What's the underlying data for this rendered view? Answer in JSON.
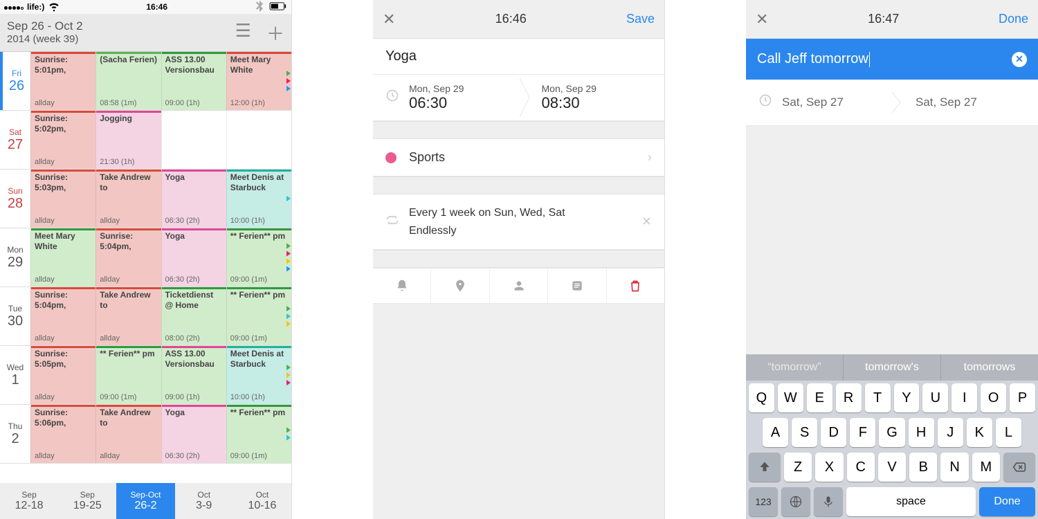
{
  "screen1": {
    "statusbar": {
      "carrier": "life:)",
      "time": "16:46"
    },
    "header": {
      "range": "Sep 26 - Oct 2",
      "subtitle": "2014 (week 39)"
    },
    "days": [
      {
        "dow": "Fri",
        "num": "26",
        "today": true,
        "events": [
          {
            "title": "Sunrise: 5:01pm,",
            "time": "allday",
            "bg": "#f2c7c3",
            "bar": "#d94a3a"
          },
          {
            "title": "(Sacha Ferien)",
            "time": "08:58 (1m)",
            "bg": "#d1eccb",
            "bar": "#5fb35b"
          },
          {
            "title": "ASS 13.00 Versionsbau",
            "time": "09:00 (1h)",
            "bg": "#d1eccb",
            "bar": "#2e9a3e"
          },
          {
            "title": "Meet Mary White",
            "time": "12:00 (1h)",
            "bg": "#f2c7c3",
            "bar": "#d94a3a"
          }
        ],
        "markers": [
          "#4caf50",
          "#e91e63",
          "#2196f3"
        ]
      },
      {
        "dow": "Sat",
        "num": "27",
        "weekend": true,
        "events": [
          {
            "title": "Sunrise: 5:02pm,",
            "time": "allday",
            "bg": "#f2c7c3",
            "bar": "#d94a3a"
          },
          {
            "title": "Jogging",
            "time": "21:30 (1h)",
            "bg": "#f4d3e3",
            "bar": "#e04893"
          },
          {
            "empty": true
          },
          {
            "empty": true
          }
        ]
      },
      {
        "dow": "Sun",
        "num": "28",
        "weekend": true,
        "events": [
          {
            "title": "Sunrise: 5:03pm,",
            "time": "allday",
            "bg": "#f2c7c3",
            "bar": "#d94a3a"
          },
          {
            "title": "Take Andrew to",
            "time": "allday",
            "bg": "#f2c7c3",
            "bar": "#d94a3a"
          },
          {
            "title": "Yoga",
            "time": "06:30 (2h)",
            "bg": "#f4d3e3",
            "bar": "#e04893"
          },
          {
            "title": "Meet Denis at Starbuck",
            "time": "10:00 (1h)",
            "bg": "#c6ece6",
            "bar": "#1fb2a0"
          }
        ],
        "markers": [
          "#26c6da"
        ]
      },
      {
        "dow": "Mon",
        "num": "29",
        "events": [
          {
            "title": "Meet Mary White",
            "time": "allday",
            "bg": "#d1eccb",
            "bar": "#2e9a3e"
          },
          {
            "title": "Sunrise: 5:04pm,",
            "time": "allday",
            "bg": "#f2c7c3",
            "bar": "#d94a3a"
          },
          {
            "title": "Yoga",
            "time": "06:30 (2h)",
            "bg": "#f4d3e3",
            "bar": "#e04893"
          },
          {
            "title": "** Ferien** pm",
            "time": "09:00 (1m)",
            "bg": "#d1eccb",
            "bar": "#2e9a3e"
          }
        ],
        "markers": [
          "#4caf50",
          "#e91e63",
          "#ffc107",
          "#2196f3"
        ]
      },
      {
        "dow": "Tue",
        "num": "30",
        "events": [
          {
            "title": "Sunrise: 5:04pm,",
            "time": "allday",
            "bg": "#f2c7c3",
            "bar": "#d94a3a"
          },
          {
            "title": "Take Andrew to",
            "time": "allday",
            "bg": "#f2c7c3",
            "bar": "#d94a3a"
          },
          {
            "title": "Ticketdienst @ Home",
            "time": "08:00 (2h)",
            "bg": "#d1eccb",
            "bar": "#2e9a3e"
          },
          {
            "title": "** Ferien** pm",
            "time": "09:00 (1m)",
            "bg": "#d1eccb",
            "bar": "#2e9a3e"
          }
        ],
        "markers": [
          "#4caf50",
          "#26c6da",
          "#ffc107"
        ]
      },
      {
        "dow": "Wed",
        "num": "1",
        "events": [
          {
            "title": "Sunrise: 5:05pm,",
            "time": "allday",
            "bg": "#f2c7c3",
            "bar": "#d94a3a"
          },
          {
            "title": "** Ferien** pm",
            "time": "09:00 (1m)",
            "bg": "#d1eccb",
            "bar": "#2e9a3e"
          },
          {
            "title": "ASS 13.00 Versionsbau",
            "time": "09:00 (1h)",
            "bg": "#d1eccb",
            "bar": "#e04893"
          },
          {
            "title": "Meet Denis at Starbuck",
            "time": "10:00 (1h)",
            "bg": "#c6ece6",
            "bar": "#1fb2a0"
          }
        ],
        "markers": [
          "#4caf50",
          "#ffc107",
          "#e91e63"
        ]
      },
      {
        "dow": "Thu",
        "num": "2",
        "events": [
          {
            "title": "Sunrise: 5:06pm,",
            "time": "allday",
            "bg": "#f2c7c3",
            "bar": "#d94a3a"
          },
          {
            "title": "Take Andrew to",
            "time": "allday",
            "bg": "#f2c7c3",
            "bar": "#d94a3a"
          },
          {
            "title": "Yoga",
            "time": "06:30 (2h)",
            "bg": "#f4d3e3",
            "bar": "#e04893"
          },
          {
            "title": "** Ferien** pm",
            "time": "09:00 (1m)",
            "bg": "#d1eccb",
            "bar": "#2e9a3e"
          }
        ],
        "markers": [
          "#4caf50",
          "#26c6da"
        ]
      }
    ],
    "footer": [
      {
        "top": "Sep",
        "bottom": "12-18"
      },
      {
        "top": "Sep",
        "bottom": "19-25"
      },
      {
        "top": "Sep-Oct",
        "bottom": "26-2",
        "active": true
      },
      {
        "top": "Oct",
        "bottom": "3-9"
      },
      {
        "top": "Oct",
        "bottom": "10-16"
      }
    ]
  },
  "screen2": {
    "nav": {
      "time": "16:46",
      "action": "Save"
    },
    "title": "Yoga",
    "start": {
      "date": "Mon, Sep 29",
      "time": "06:30"
    },
    "end": {
      "date": "Mon, Sep 29",
      "time": "08:30"
    },
    "calendar": "Sports",
    "repeat": {
      "rule": "Every 1 week on Sun, Wed, Sat",
      "until": "Endlessly"
    }
  },
  "screen3": {
    "nav": {
      "time": "16:47",
      "action": "Done"
    },
    "input": "Call Jeff tomorrow",
    "start_date": "Sat, Sep 27",
    "end_date": "Sat, Sep 27",
    "suggestions": [
      "“tomorrow”",
      "tomorrow's",
      "tomorrows"
    ],
    "keyboard": {
      "row1": [
        "Q",
        "W",
        "E",
        "R",
        "T",
        "Y",
        "U",
        "I",
        "O",
        "P"
      ],
      "row2": [
        "A",
        "S",
        "D",
        "F",
        "G",
        "H",
        "J",
        "K",
        "L"
      ],
      "row3": [
        "Z",
        "X",
        "C",
        "V",
        "B",
        "N",
        "M"
      ],
      "bottom": {
        "num": "123",
        "space": "space",
        "done": "Done"
      }
    }
  }
}
